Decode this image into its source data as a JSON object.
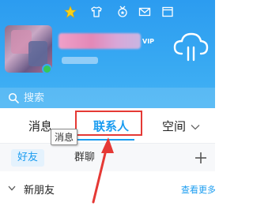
{
  "header": {
    "top_icons": [
      "star-icon",
      "tshirt-icon",
      "medal-icon",
      "mail-icon",
      "window-icon"
    ],
    "vip_badge": "VIP",
    "weather_icon": "cloud-download-icon"
  },
  "search": {
    "placeholder": "搜索"
  },
  "tabs": {
    "messages": "消息",
    "contacts": "联系人",
    "space": "空间"
  },
  "tooltip": "消息",
  "subtabs": {
    "friends": "好友",
    "groups": "群聊"
  },
  "contact_group": {
    "label": "新朋友",
    "manage": "查看更多"
  },
  "colors": {
    "header_blue": "#2c9cf0",
    "accent_blue": "#1a9cf0",
    "highlight_red": "#e53935",
    "online_green": "#35c759"
  }
}
